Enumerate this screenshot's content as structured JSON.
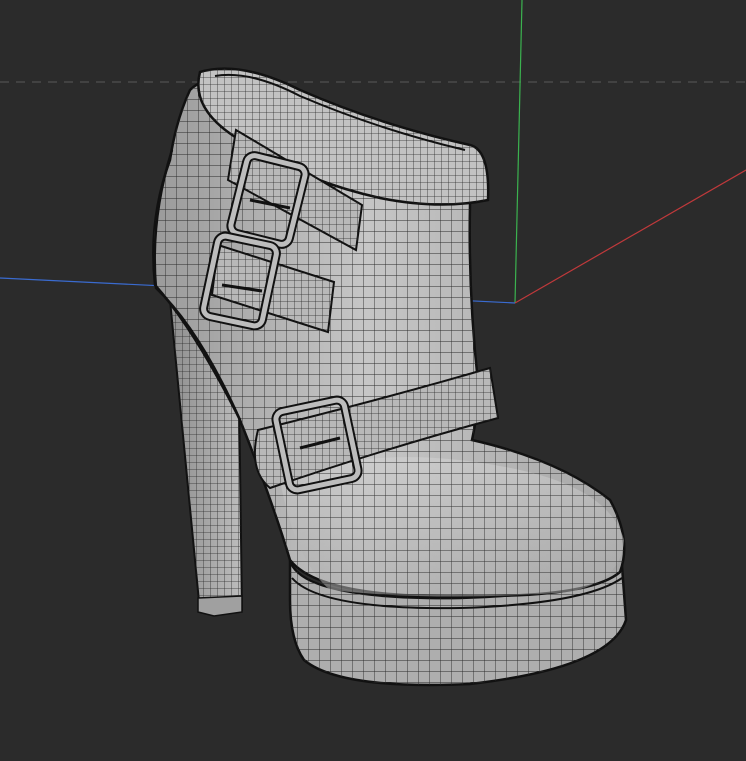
{
  "viewport": {
    "background": "#2b2b2b",
    "grid_color": "#5a5a5a",
    "axis_colors": {
      "x": "#c0393b",
      "y": "#3bb24f",
      "z": "#3a6bd0"
    }
  },
  "model": {
    "type": "high-heel ankle boot",
    "display": "wireframe-on-shaded",
    "surface_color": "#bdbdbd",
    "wire_color": "#2a2a2a",
    "buckle_count": 3
  }
}
